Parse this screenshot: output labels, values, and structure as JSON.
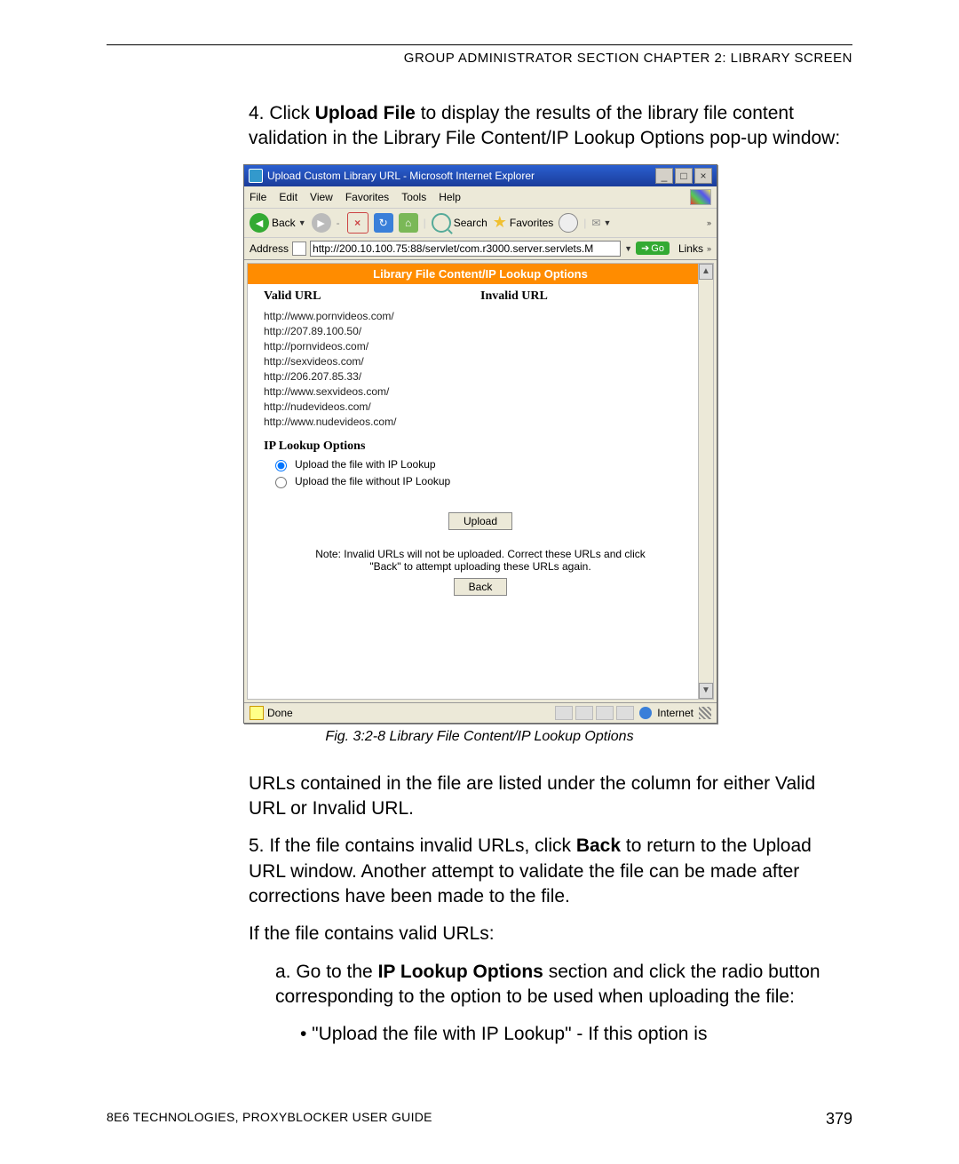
{
  "header": "GROUP ADMINISTRATOR SECTION  CHAPTER 2: LIBRARY SCREEN",
  "step4_pre": "4. Click ",
  "step4_b": "Upload File",
  "step4_post": " to display the results of the library file content validation in the Library File Content/IP Lookup Options pop-up window:",
  "caption": "Fig. 3:2-8  Library File Content/IP Lookup Options",
  "para_urls": "URLs contained in the file are listed under the column for either Valid URL or Invalid URL.",
  "step5_pre": "5. If the file contains invalid URLs, click ",
  "step5_b": "Back",
  "step5_post": " to return to the Upload URL window. Another attempt to validate the file can be made after corrections have been made to the file.",
  "if_valid": "If the file contains valid URLs:",
  "sub_a_pre": "a. Go to the ",
  "sub_a_b": "IP Lookup Options",
  "sub_a_post": " section and click the radio button corresponding to the option to be used when uploading the file:",
  "bullet1": "•  \"Upload the file with IP Lookup\" - If this option is",
  "footer_left": "8E6 TECHNOLOGIES, PROXYBLOCKER USER GUIDE",
  "footer_right": "379",
  "shot": {
    "title": "Upload Custom Library URL - Microsoft Internet Explorer",
    "menus": [
      "File",
      "Edit",
      "View",
      "Favorites",
      "Tools",
      "Help"
    ],
    "back": "Back",
    "search": "Search",
    "favorites": "Favorites",
    "addr_label": "Address",
    "addr_value": "http://200.10.100.75:88/servlet/com.r3000.server.servlets.M",
    "go": "Go",
    "links": "Links",
    "orange": "Library File Content/IP Lookup Options",
    "col1": "Valid URL",
    "col2": "Invalid URL",
    "urls": [
      "http://www.pornvideos.com/",
      "http://207.89.100.50/",
      "http://pornvideos.com/",
      "http://sexvideos.com/",
      "http://206.207.85.33/",
      "http://www.sexvideos.com/",
      "http://nudevideos.com/",
      "http://www.nudevideos.com/"
    ],
    "iplookup_h": "IP Lookup Options",
    "radio1": "Upload the file with IP Lookup",
    "radio2": "Upload the file without IP Lookup",
    "upload_btn": "Upload",
    "note1": "Note: Invalid URLs will not be uploaded. Correct these URLs and click",
    "note2": "\"Back\" to attempt uploading these URLs again.",
    "back_btn": "Back",
    "status_done": "Done",
    "status_net": "Internet"
  }
}
